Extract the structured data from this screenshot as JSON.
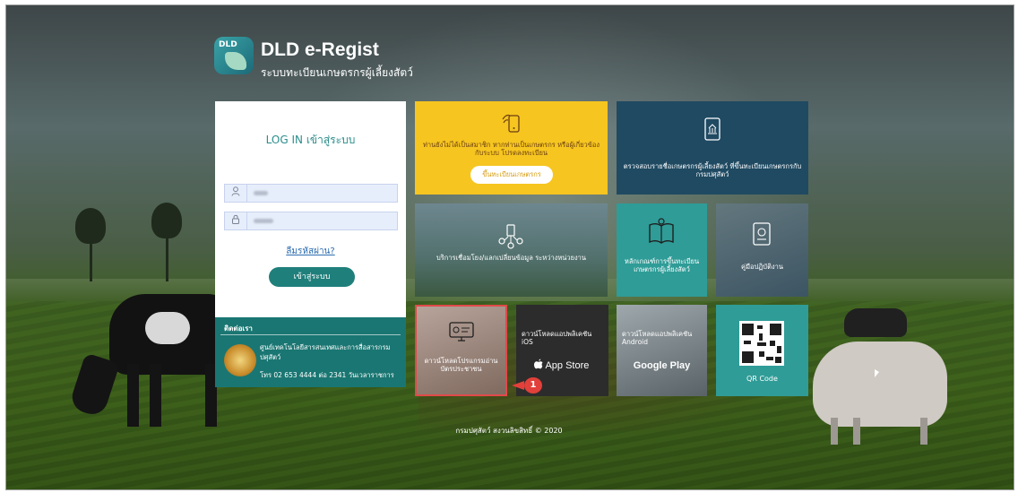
{
  "brand": {
    "logo_text": "DLD",
    "title": "DLD e-Regist",
    "subtitle": "ระบบทะเบียนเกษตรกรผู้เลี้ยงสัตว์"
  },
  "login": {
    "title": "LOG IN เข้าสู่ระบบ",
    "forgot_label": "ลืมรหัสผ่าน?",
    "submit_label": "เข้าสู่ระบบ"
  },
  "contact": {
    "header": "ติดต่อเรา",
    "org": "ศูนย์เทคโนโลยีสารสนเทศและการสื่อสารกรมปศุสัตว์",
    "tel": "โทร 02 653 4444 ต่อ 2341 วันเวลาราชการ"
  },
  "tiles": {
    "register": {
      "text": "ท่านยังไม่ได้เป็นสมาชิก หากท่านเป็นเกษตรกร หรือผู้เกี่ยวข้องกับระบบ โปรดลงทะเบียน",
      "button": "ขึ้นทะเบียนเกษตรกร"
    },
    "check": {
      "text": "ตรวจสอบรายชื่อเกษตรกรผู้เลี้ยงสัตว์ ที่ขึ้นทะเบียนเกษตรกรกับกรมปศุสัตว์"
    },
    "service": {
      "text": "บริการเชื่อมโยง/แลกเปลี่ยนข้อมูล ระหว่างหน่วยงาน"
    },
    "criteria": {
      "text": "หลักเกณฑ์การขึ้นทะเบียนเกษตรกรผู้เลี้ยงสัตว์"
    },
    "manual": {
      "text": "คู่มือปฏิบัติงาน"
    },
    "download": {
      "text": "ดาวน์โหลดโปรแกรมอ่านบัตรประชาชน"
    },
    "ios": {
      "text": "ดาวน์โหลดแอปพลิเคชัน iOS",
      "store": "App Store"
    },
    "android": {
      "text": "ดาวน์โหลดแอปพลิเคชัน Android",
      "store": "Google Play"
    },
    "qr": {
      "text": "QR Code"
    }
  },
  "annotation": {
    "badge": "1"
  },
  "footer": {
    "text": "กรมปศุสัตว์ สงวนลิขสิทธิ์ © 2020"
  },
  "colors": {
    "teal": "#1a7672",
    "yellow": "#f6c520",
    "navy": "#1f4a62",
    "highlight": "#e04a4a"
  }
}
